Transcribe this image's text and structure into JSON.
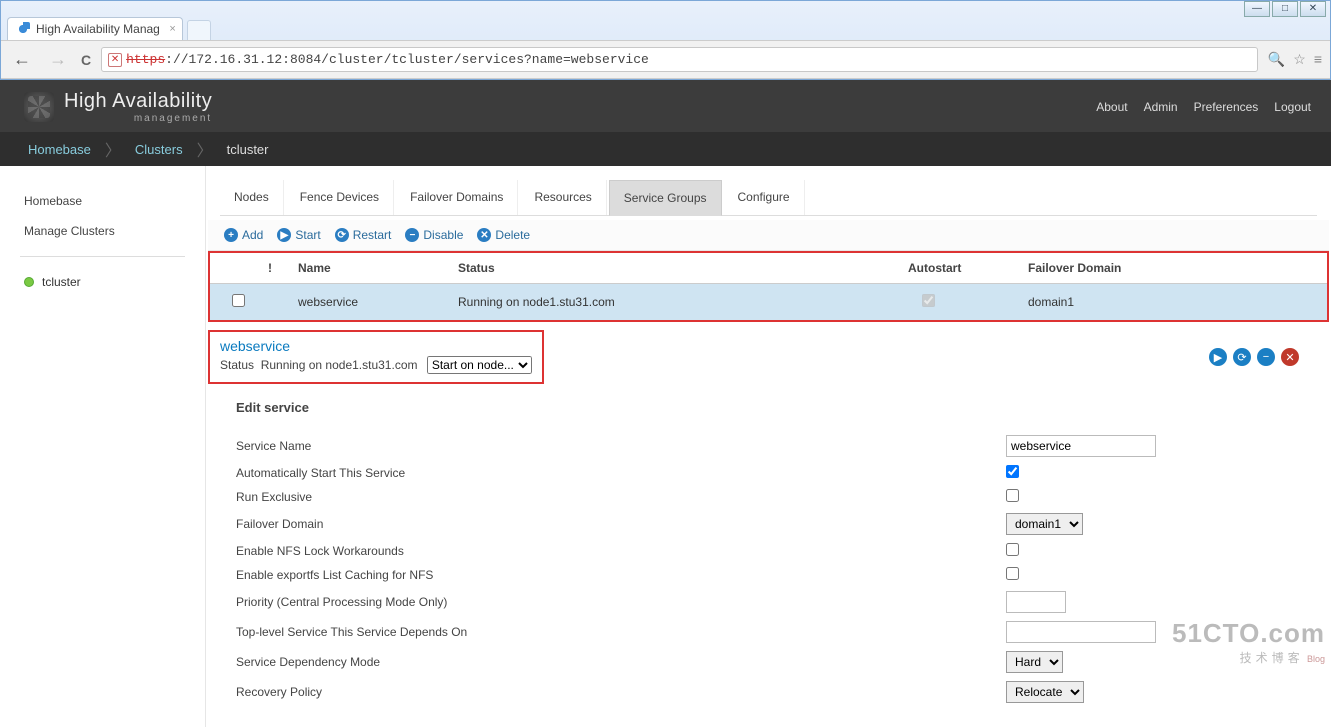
{
  "browser": {
    "tab_title": "High Availability Manag",
    "url_scheme": "https",
    "url_rest": "://172.16.31.12:8084/cluster/tcluster/services?name=webservice"
  },
  "header": {
    "brand_line1": "High Availability",
    "brand_line2": "management",
    "links": [
      "About",
      "Admin",
      "Preferences",
      "Logout"
    ]
  },
  "breadcrumb": {
    "items": [
      "Homebase",
      "Clusters",
      "tcluster"
    ],
    "current_index": 2
  },
  "sidebar": {
    "links": [
      "Homebase",
      "Manage Clusters"
    ],
    "cluster": "tcluster"
  },
  "tabs": {
    "items": [
      "Nodes",
      "Fence Devices",
      "Failover Domains",
      "Resources",
      "Service Groups",
      "Configure"
    ],
    "active_index": 4
  },
  "actions": [
    "Add",
    "Start",
    "Restart",
    "Disable",
    "Delete"
  ],
  "action_icons": [
    "+",
    "▶",
    "⟳",
    "−",
    "✕"
  ],
  "grid": {
    "columns": [
      "!",
      "Name",
      "Status",
      "Autostart",
      "Failover Domain"
    ],
    "row": {
      "name": "webservice",
      "status": "Running on node1.stu31.com",
      "autostart": true,
      "failover_domain": "domain1"
    }
  },
  "detail": {
    "title": "webservice",
    "status_label": "Status",
    "status_value": "Running on node1.stu31.com",
    "start_on_label": "Start on node...",
    "buttons": [
      "start",
      "refresh",
      "disable",
      "delete"
    ]
  },
  "form": {
    "section_title": "Edit service",
    "fields": {
      "service_name": {
        "label": "Service Name",
        "value": "webservice"
      },
      "autostart": {
        "label": "Automatically Start This Service",
        "checked": true
      },
      "run_exclusive": {
        "label": "Run Exclusive",
        "checked": false
      },
      "failover_domain": {
        "label": "Failover Domain",
        "value": "domain1"
      },
      "nfs_lock": {
        "label": "Enable NFS Lock Workarounds",
        "checked": false
      },
      "exportfs": {
        "label": "Enable exportfs List Caching for NFS",
        "checked": false
      },
      "priority": {
        "label": "Priority (Central Processing Mode Only)",
        "value": ""
      },
      "depends_on": {
        "label": "Top-level Service This Service Depends On",
        "value": ""
      },
      "dep_mode": {
        "label": "Service Dependency Mode",
        "value": "Hard"
      },
      "recovery": {
        "label": "Recovery Policy",
        "value": "Relocate"
      }
    }
  },
  "watermark": {
    "big": "51CTO.com",
    "small": "技术博客",
    "blog": "Blog"
  }
}
